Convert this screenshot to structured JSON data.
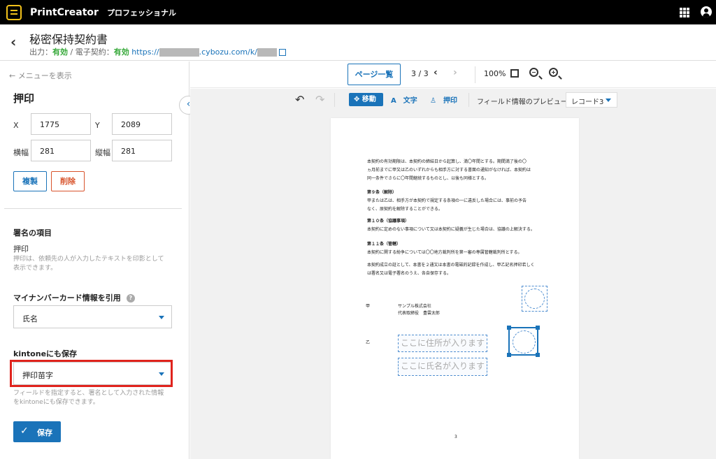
{
  "app": {
    "name": "PrintCreator",
    "edition": "プロフェッショナル"
  },
  "header": {
    "title": "秘密保持契約書",
    "output_label": "出力：",
    "output_value": "有効",
    "separator": " / ",
    "contract_label": "電子契約：",
    "contract_value": "有効",
    "url_prefix": "https://",
    "url_suffix": ".cybozu.com/k/"
  },
  "left_panel": {
    "menu_link": "メニューを表示",
    "section_title": "押印",
    "x_label": "X",
    "x_value": "1775",
    "y_label": "Y",
    "y_value": "2089",
    "width_label": "横幅",
    "width_value": "281",
    "height_label": "縦幅",
    "height_value": "281",
    "copy_button": "複製",
    "delete_button": "削除",
    "signature_item_title": "署名の項目",
    "signature_item_value": "押印",
    "signature_item_desc_1": "押印は、依頼先の人が入力したテキストを印影として",
    "signature_item_desc_2": "表示できます。",
    "mynumber_title": "マイナンバーカード情報を引用",
    "mynumber_selected": "氏名",
    "kintone_title": "kintoneにも保存",
    "kintone_selected": "押印苗字",
    "kintone_desc_1": "フィールドを指定すると、署名として入力された情報",
    "kintone_desc_2": "をkintoneにも保存できます。",
    "save_button": "保存"
  },
  "viewer": {
    "page_list_button": "ページ一覧",
    "page_indicator": "3 / 3",
    "zoom": "100%",
    "tools": {
      "move": "移動",
      "text": "文字",
      "stamp": "押印"
    },
    "preview_label": "フィールド情報のプレビュー",
    "record": "レコード3"
  },
  "document": {
    "p1": "本契約の有効期限は、本契約の締結日から起算し、満〇年間とする。期間満了後の〇\nヵ月前までに甲又は乙のいずれからも相手方に対する書面の通知がなければ、本契約は\n同一条件でさらに〇年間継続するものとし、以後も同様とする。",
    "a9_title": "第９条（解除）",
    "a9_body": "甲または乙は、相手方が本契約で規定する条項の一に違反した場合には、事前の予告\nなく、原契約を解除することができる。",
    "a10_title": "第１０条（協議事項）",
    "a10_body": "本契約に定めのない事項について又は本契約に疑義が生じた場合は、協議の上解決する。",
    "a11_title": "第１１条（管轄）",
    "a11_body": "本契約に関する紛争については〇〇地方裁判所を第一審の専属管轄裁判所とする。",
    "closing": "本契約成立の証として、本書を２通又は本書の電磁的記録を作成し、甲乙記名押印若しく\nは署名又は電子署名のうえ、各自保存する。",
    "party_a": "甲",
    "party_a_company": "サンプル株式会社",
    "party_a_person": "代表取締役　豊雲太郎",
    "party_b": "乙",
    "address_placeholder": "ここに住所が入ります",
    "name_placeholder": "ここに氏名が入ります",
    "page_number": "3"
  },
  "icons": {
    "menu_back": "arrow-left-icon",
    "apps": "grid-icon",
    "user": "user-circle-icon"
  }
}
